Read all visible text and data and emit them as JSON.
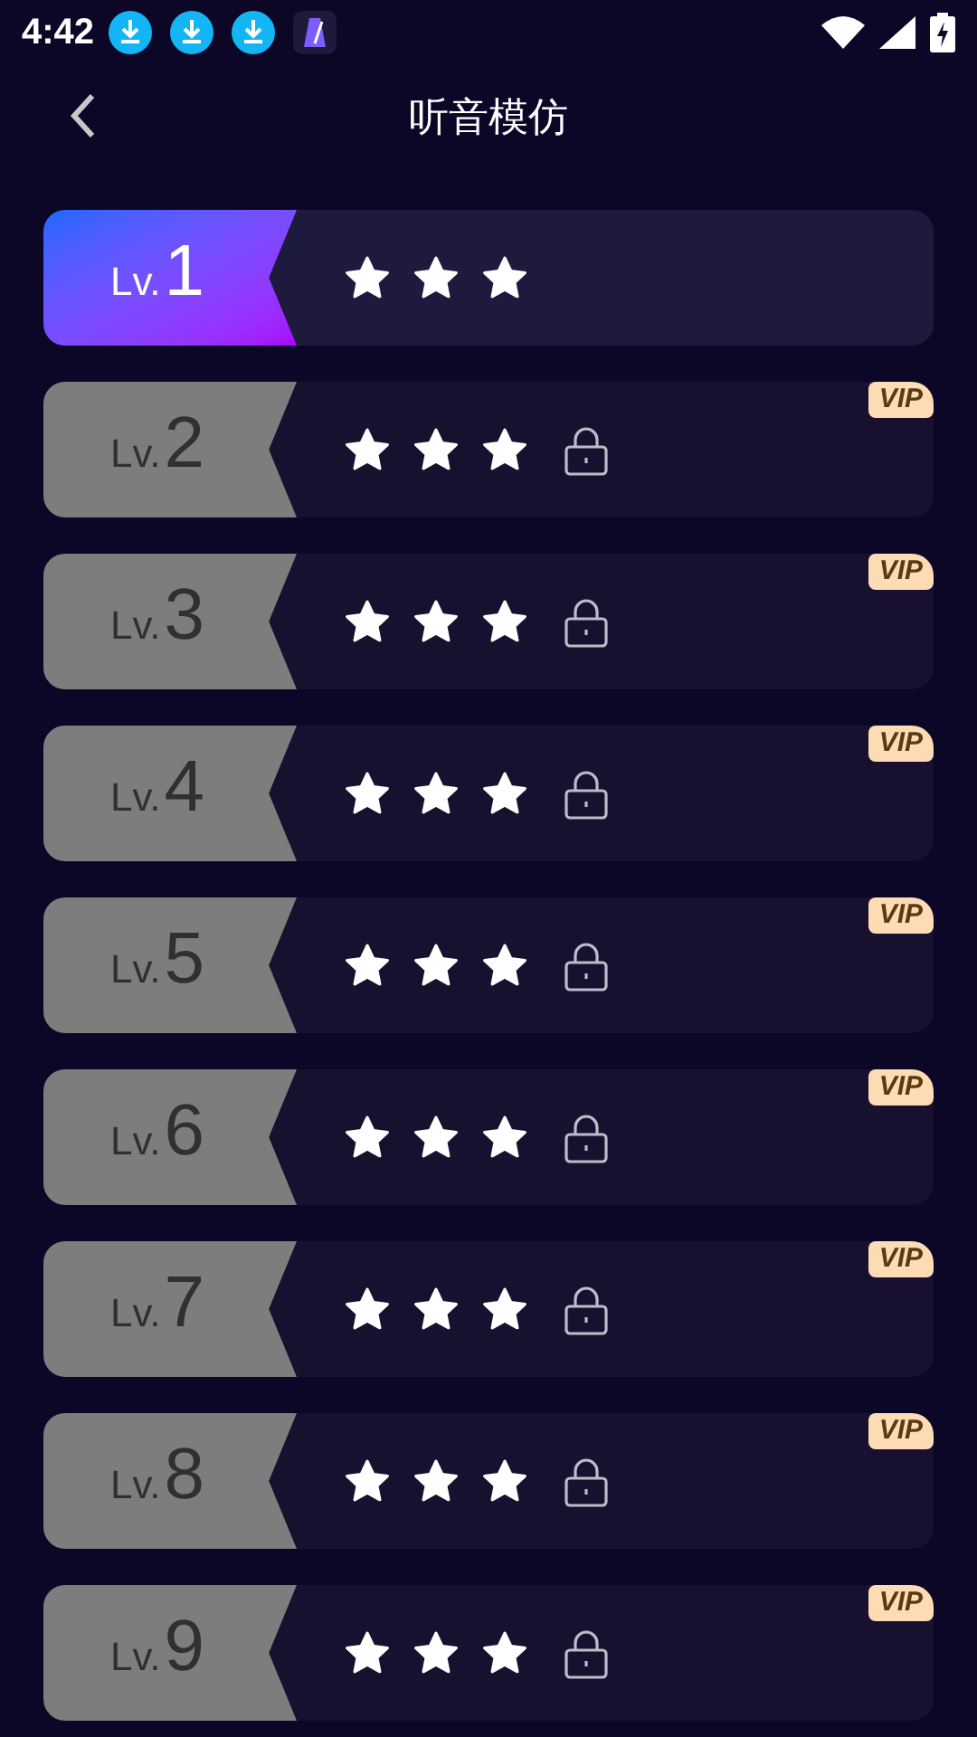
{
  "status_bar": {
    "time": "4:42"
  },
  "header": {
    "title": "听音模仿"
  },
  "levels": [
    {
      "prefix": "Lv.",
      "number": "1",
      "stars": 3,
      "locked": false
    },
    {
      "prefix": "Lv.",
      "number": "2",
      "stars": 3,
      "locked": true,
      "badge": "VIP"
    },
    {
      "prefix": "Lv.",
      "number": "3",
      "stars": 3,
      "locked": true,
      "badge": "VIP"
    },
    {
      "prefix": "Lv.",
      "number": "4",
      "stars": 3,
      "locked": true,
      "badge": "VIP"
    },
    {
      "prefix": "Lv.",
      "number": "5",
      "stars": 3,
      "locked": true,
      "badge": "VIP"
    },
    {
      "prefix": "Lv.",
      "number": "6",
      "stars": 3,
      "locked": true,
      "badge": "VIP"
    },
    {
      "prefix": "Lv.",
      "number": "7",
      "stars": 3,
      "locked": true,
      "badge": "VIP"
    },
    {
      "prefix": "Lv.",
      "number": "8",
      "stars": 3,
      "locked": true,
      "badge": "VIP"
    },
    {
      "prefix": "Lv.",
      "number": "9",
      "stars": 3,
      "locked": true,
      "badge": "VIP"
    }
  ]
}
